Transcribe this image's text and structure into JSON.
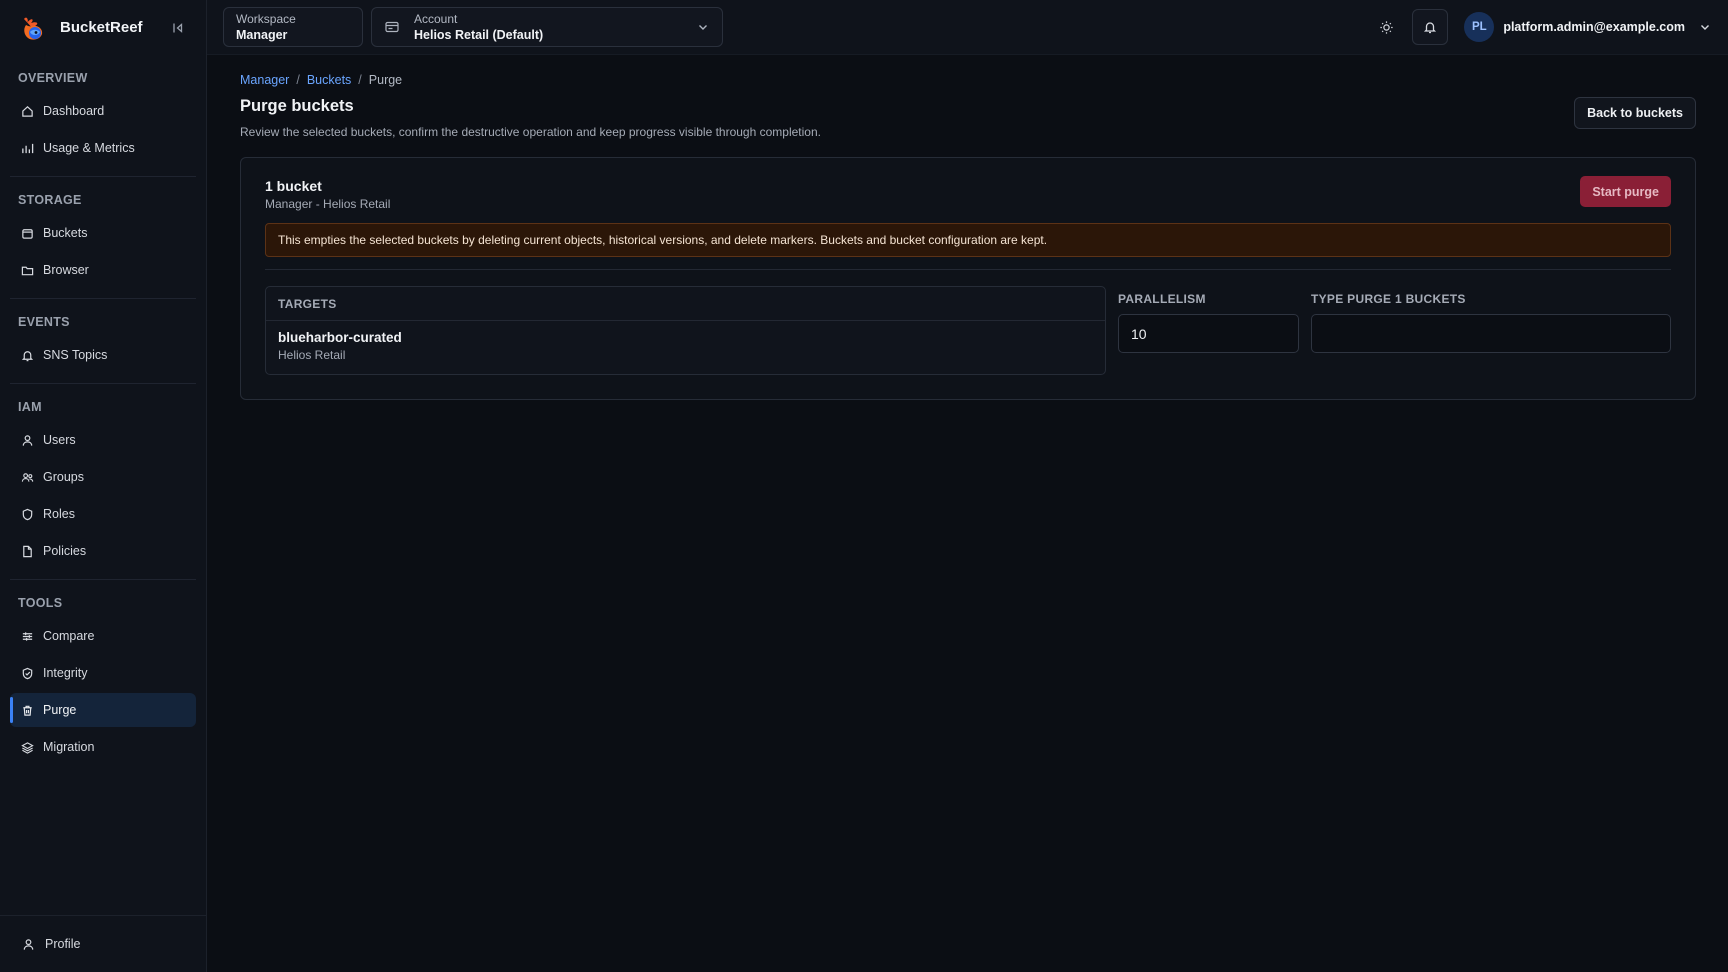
{
  "brand": {
    "name": "BucketReef"
  },
  "sidebar": {
    "sections": [
      {
        "heading": "OVERVIEW",
        "items": [
          {
            "label": "Dashboard",
            "icon": "home-icon"
          },
          {
            "label": "Usage & Metrics",
            "icon": "bar-chart-icon"
          }
        ]
      },
      {
        "heading": "STORAGE",
        "items": [
          {
            "label": "Buckets",
            "icon": "bucket-icon"
          },
          {
            "label": "Browser",
            "icon": "folder-icon"
          }
        ]
      },
      {
        "heading": "EVENTS",
        "items": [
          {
            "label": "SNS Topics",
            "icon": "bell-icon"
          }
        ]
      },
      {
        "heading": "IAM",
        "items": [
          {
            "label": "Users",
            "icon": "user-icon"
          },
          {
            "label": "Groups",
            "icon": "users-icon"
          },
          {
            "label": "Roles",
            "icon": "shield-icon"
          },
          {
            "label": "Policies",
            "icon": "file-icon"
          }
        ]
      },
      {
        "heading": "TOOLS",
        "items": [
          {
            "label": "Compare",
            "icon": "sliders-icon"
          },
          {
            "label": "Integrity",
            "icon": "shield-check-icon"
          },
          {
            "label": "Purge",
            "icon": "trash-icon",
            "active": true
          },
          {
            "label": "Migration",
            "icon": "layers-icon"
          }
        ]
      }
    ],
    "footer": {
      "label": "Profile",
      "icon": "user-icon"
    }
  },
  "topbar": {
    "workspace": {
      "label": "Workspace",
      "value": "Manager"
    },
    "account": {
      "label": "Account",
      "value": "Helios Retail (Default)"
    },
    "user": {
      "initials": "PL",
      "email": "platform.admin@example.com"
    }
  },
  "breadcrumb": {
    "items": [
      "Manager",
      "Buckets"
    ],
    "separator": "/",
    "current": "Purge"
  },
  "page": {
    "title": "Purge buckets",
    "description": "Review the selected buckets, confirm the destructive operation and keep progress visible through completion.",
    "back_label": "Back to buckets"
  },
  "card": {
    "title": "1 bucket",
    "subtitle": "Manager - Helios Retail",
    "start_label": "Start purge",
    "warning": "This empties the selected buckets by deleting current objects, historical versions, and delete markers. Buckets and bucket configuration are kept.",
    "targets_heading": "TARGETS",
    "targets": [
      {
        "name": "blueharbor-curated",
        "account": "Helios Retail"
      }
    ],
    "parallelism_label": "PARALLELISM",
    "parallelism_value": "10",
    "confirm_label": "TYPE PURGE 1 BUCKETS",
    "confirm_value": ""
  },
  "colors": {
    "accent": "#3b82f6",
    "danger": "#8a1f36",
    "warning_bg": "#2b1608",
    "link": "#6aa5ff"
  }
}
